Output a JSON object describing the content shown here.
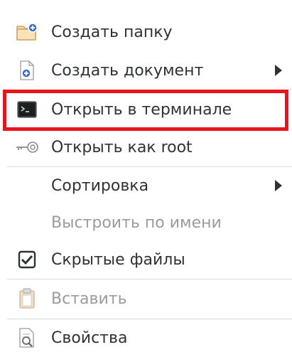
{
  "menu": {
    "items": [
      {
        "label": "Создать папку",
        "icon": "new-folder-icon"
      },
      {
        "label": "Создать документ",
        "icon": "new-document-icon",
        "submenu": true
      },
      {
        "label": "Открыть в терминале",
        "icon": "terminal-icon"
      },
      {
        "label": "Открыть как root",
        "icon": "key-icon"
      },
      {
        "label": "Сортировка",
        "submenu": true
      },
      {
        "label": "Выстроить по имени",
        "disabled": true
      },
      {
        "label": "Скрытые файлы",
        "icon": "checkbox-checked-icon",
        "checked": true
      },
      {
        "label": "Вставить",
        "icon": "paste-icon",
        "disabled": true
      },
      {
        "label": "Свойства",
        "icon": "properties-icon"
      }
    ]
  },
  "colors": {
    "highlight_border": "#e8141c",
    "text": "#2e3436",
    "disabled_text": "#9a9c9a"
  }
}
